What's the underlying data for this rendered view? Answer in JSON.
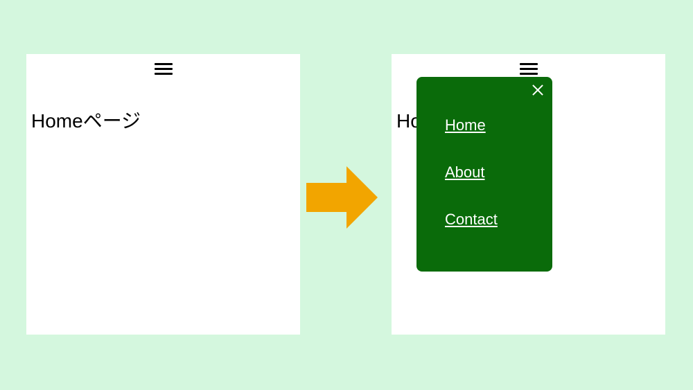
{
  "page_title": "Homeページ",
  "menu": {
    "items": [
      {
        "label": "Home"
      },
      {
        "label": "About"
      },
      {
        "label": "Contact"
      }
    ]
  }
}
